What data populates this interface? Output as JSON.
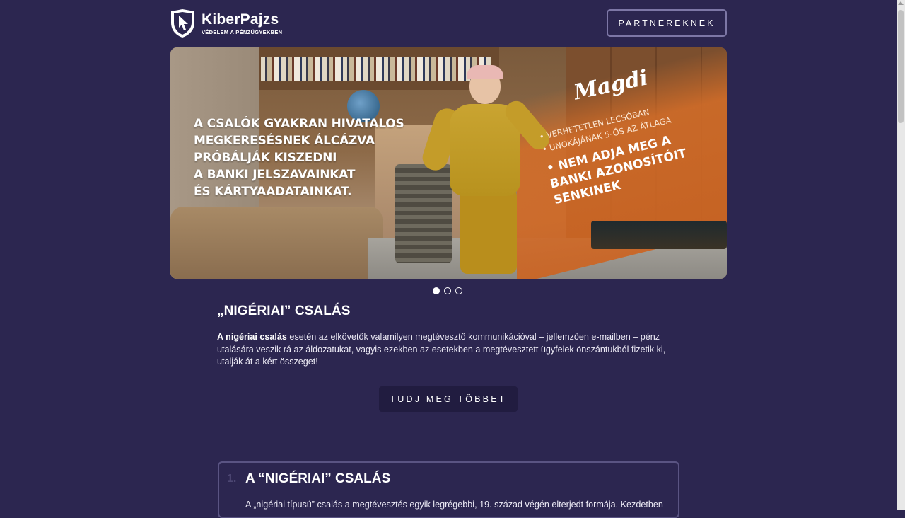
{
  "header": {
    "brand_name": "KiberPajzs",
    "brand_tagline": "VÉDELEM A PÉNZÜGYEKBEN",
    "partner_button": "PARTNEREKNEK"
  },
  "hero": {
    "headline_lines": [
      "A CSALÓK GYAKRAN HIVATALOS",
      "MEGKERESÉSNEK ÁLCÁZVA",
      "PRÓBÁLJÁK KISZEDNI",
      "A BANKI JELSZAVAINKAT",
      "ÉS KÁRTYAADATAINKAT."
    ],
    "name": "Magdi",
    "bullets_small": [
      "• VERHETETLEN LECSÓBAN",
      "• UNOKÁJÁNAK 5-ÖS AZ ÁTLAGA"
    ],
    "bullet_big_lines": [
      "• NEM ADJA MEG A",
      "BANKI AZONOSÍTÓIT",
      "SENKINEK"
    ]
  },
  "carousel": {
    "slides": 3,
    "active_index": 0
  },
  "article": {
    "title": "„NIGÉRIAI” CSALÁS",
    "lead_bold": "A nigériai csalás",
    "body": " esetén az elkövetők valamilyen megtévesztő kommunikációval – jellemzően e-mailben – pénz utalására veszik rá az áldozatukat, vagyis ezekben az esetekben a megtévesztett ügyfelek önszántukból fizetik ki, utalják át a kért összeget!",
    "more_button": "TUDJ MEG TÖBBET"
  },
  "card": {
    "number": "1.",
    "title": "A “NIGÉRIAI” CSALÁS",
    "text": "A „nigériai típusú” csalás a megtévesztés egyik legrégebbi, 19. század végén elterjedt formája. Kezdetben"
  },
  "colors": {
    "background": "#2c2650",
    "button_dark": "#211c40",
    "border": "#7d77a6",
    "accent_orange": "#cc6422"
  },
  "icons": {
    "logo": "shield-cursor-icon"
  }
}
